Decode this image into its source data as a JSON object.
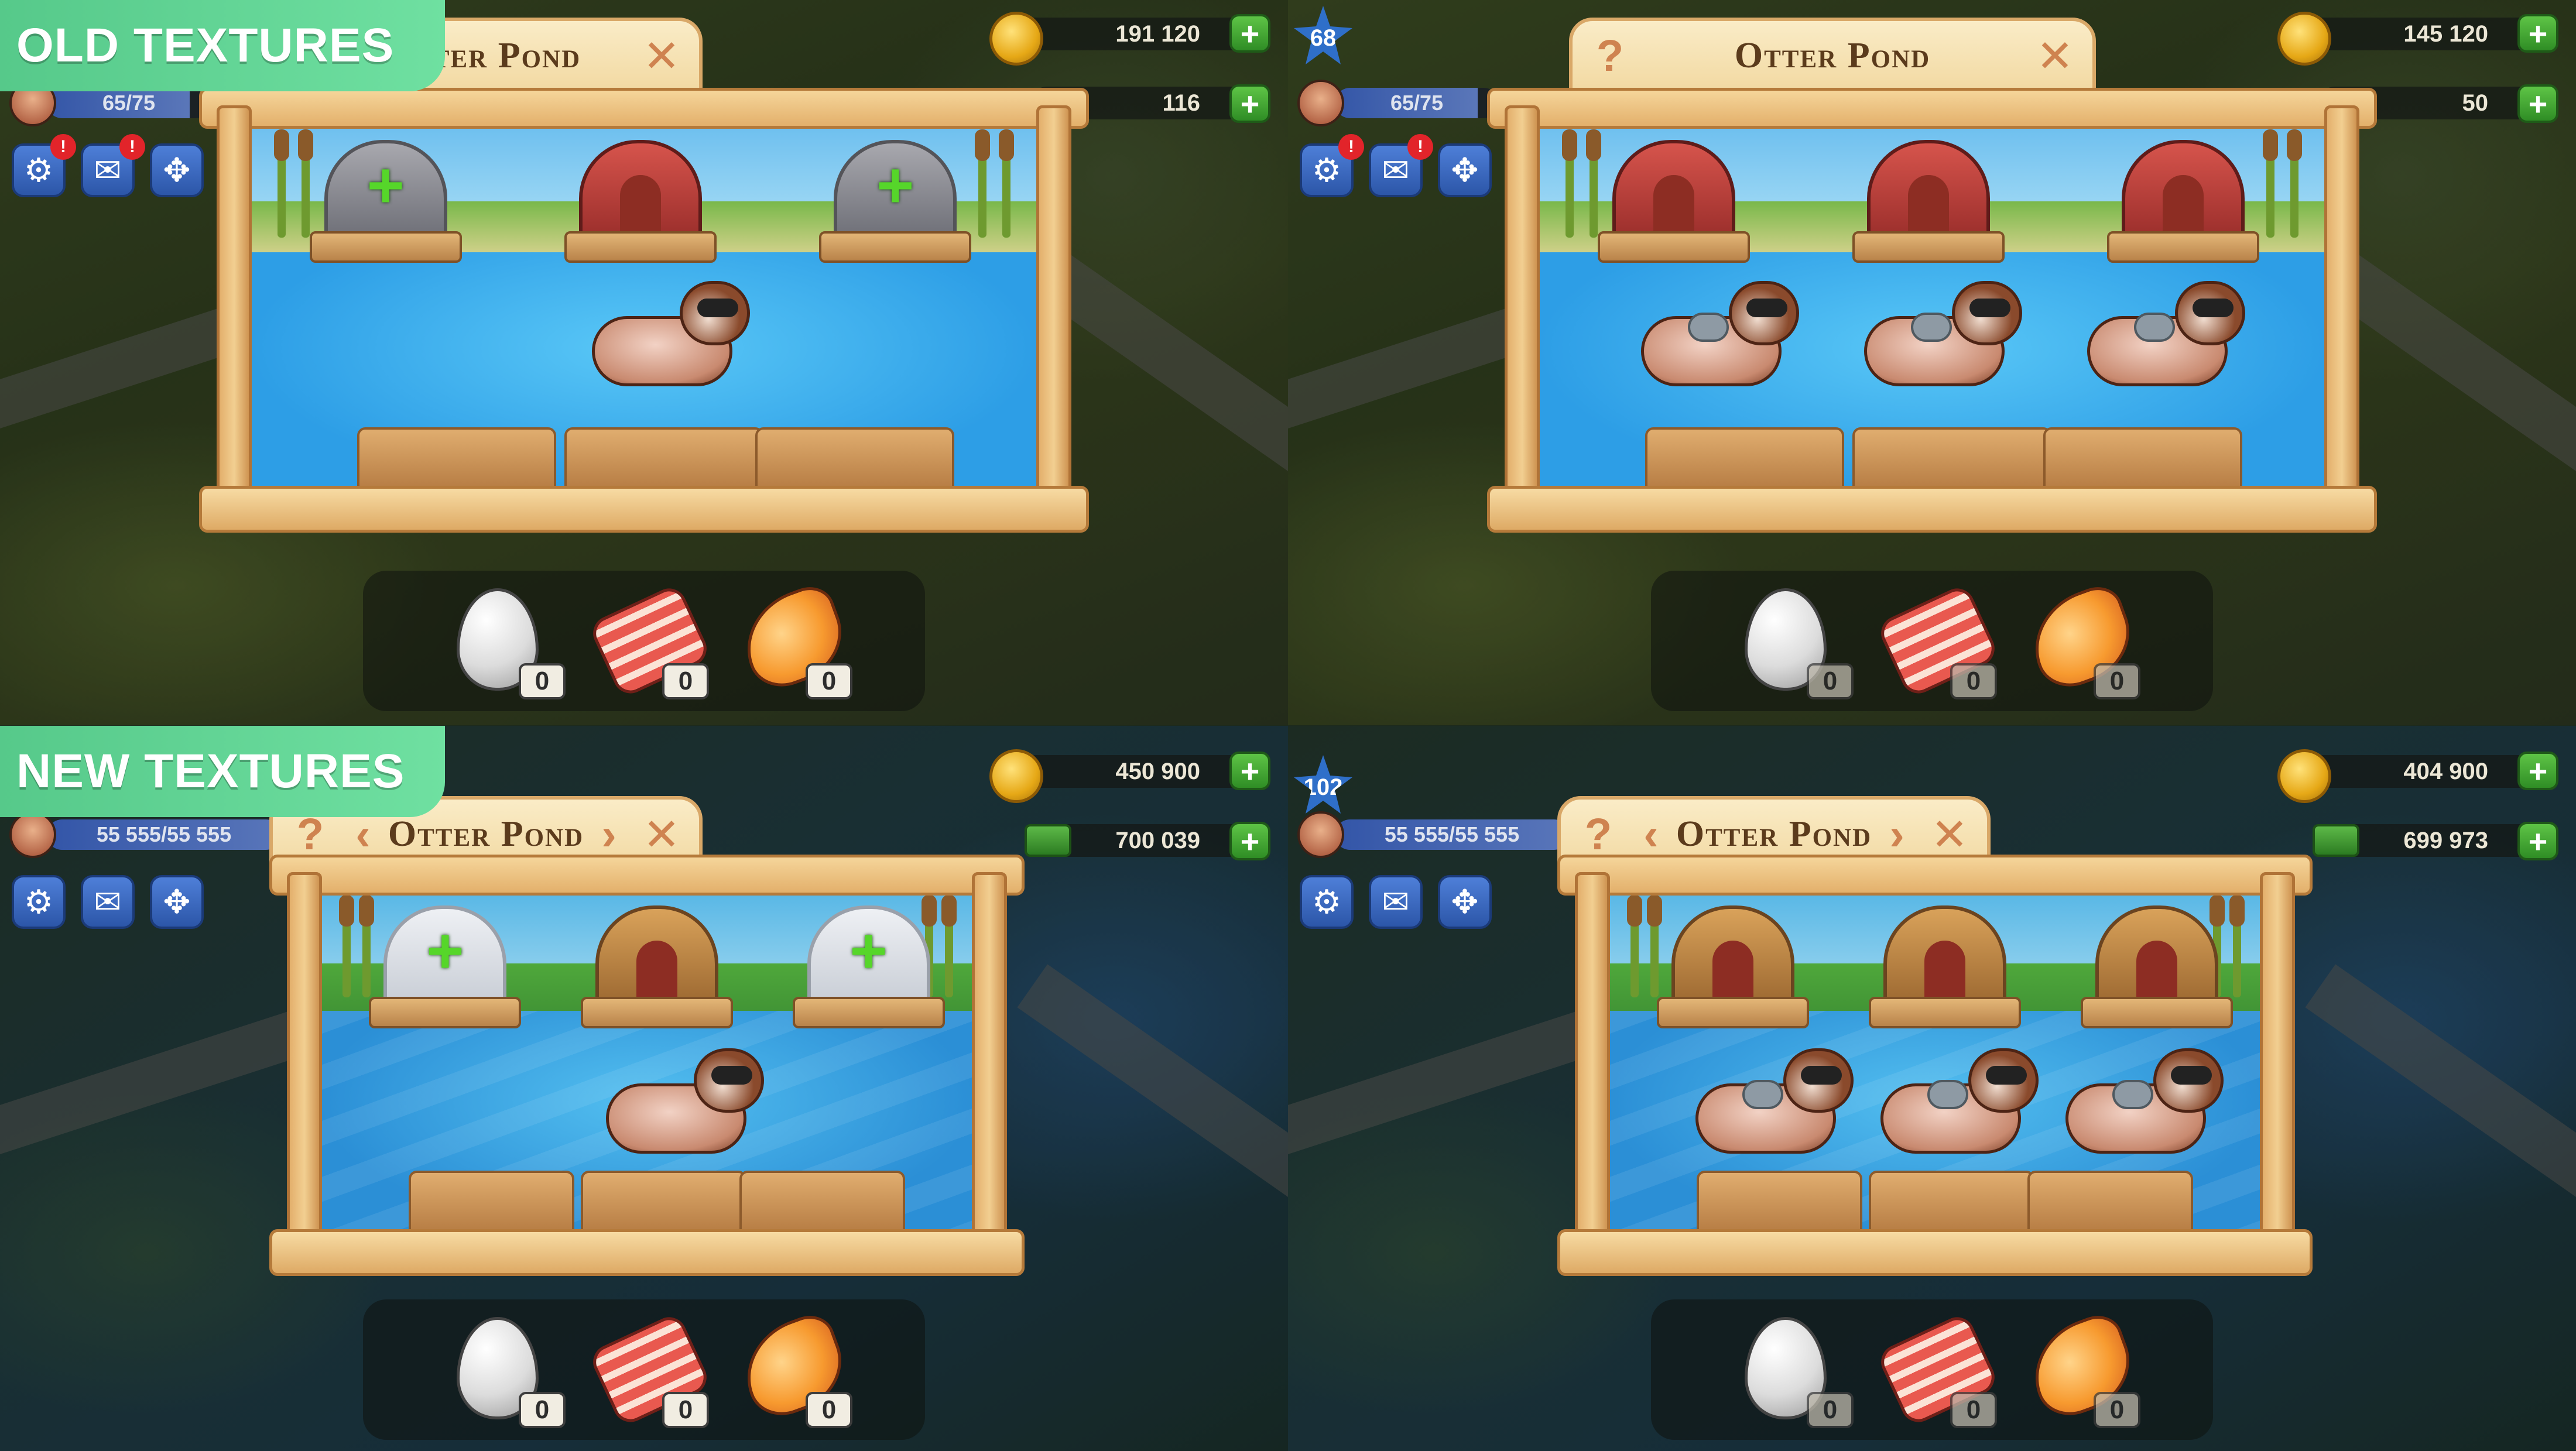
{
  "labels": {
    "old": "OLD TEXTURES",
    "new": "NEW TEXTURES"
  },
  "icons": {
    "help": "?",
    "close": "✕",
    "prev": "‹",
    "next": "›",
    "plus": "+",
    "settings": "⚙",
    "mail": "✉",
    "move": "✥",
    "alert": "!"
  },
  "panels": [
    {
      "title": "Otter Pond",
      "texture": "old",
      "coins": "191 120",
      "cash": "116",
      "level": "",
      "xp": "65/75",
      "xp_fraction": 0.87,
      "has_help": false,
      "has_nav": false,
      "houses_built": [
        false,
        true,
        false
      ],
      "otters": 1,
      "resources": [
        {
          "name": "egg",
          "count": "0"
        },
        {
          "name": "bacon",
          "count": "0"
        },
        {
          "name": "salmon",
          "count": "0"
        }
      ]
    },
    {
      "title": "Otter Pond",
      "texture": "old",
      "coins": "145 120",
      "cash": "50",
      "level": "68",
      "xp": "65/75",
      "xp_fraction": 0.87,
      "has_help": true,
      "has_nav": false,
      "houses_built": [
        true,
        true,
        true
      ],
      "otters": 3,
      "resources": [
        {
          "name": "egg",
          "count": "0"
        },
        {
          "name": "bacon",
          "count": "0"
        },
        {
          "name": "salmon",
          "count": "0"
        }
      ]
    },
    {
      "title": "Otter Pond",
      "texture": "new",
      "coins": "450 900",
      "cash": "700 039",
      "level": "",
      "xp": "55 555/55 555",
      "xp_fraction": 1.0,
      "has_help": true,
      "has_nav": true,
      "houses_built": [
        false,
        true,
        false
      ],
      "otters": 1,
      "resources": [
        {
          "name": "egg",
          "count": "0"
        },
        {
          "name": "bacon",
          "count": "0"
        },
        {
          "name": "salmon",
          "count": "0"
        }
      ]
    },
    {
      "title": "Otter Pond",
      "texture": "new",
      "coins": "404 900",
      "cash": "699 973",
      "level": "102",
      "xp": "55 555/55 555",
      "xp_fraction": 1.0,
      "has_help": true,
      "has_nav": true,
      "houses_built": [
        true,
        true,
        true
      ],
      "otters": 3,
      "resources": [
        {
          "name": "egg",
          "count": "0"
        },
        {
          "name": "bacon",
          "count": "0"
        },
        {
          "name": "salmon",
          "count": "0"
        }
      ]
    }
  ],
  "colors": {
    "label_green": "#5fd494",
    "title_text": "#5b3b1c",
    "close_orange": "#cf8350",
    "plus_green": "#56d62a"
  }
}
